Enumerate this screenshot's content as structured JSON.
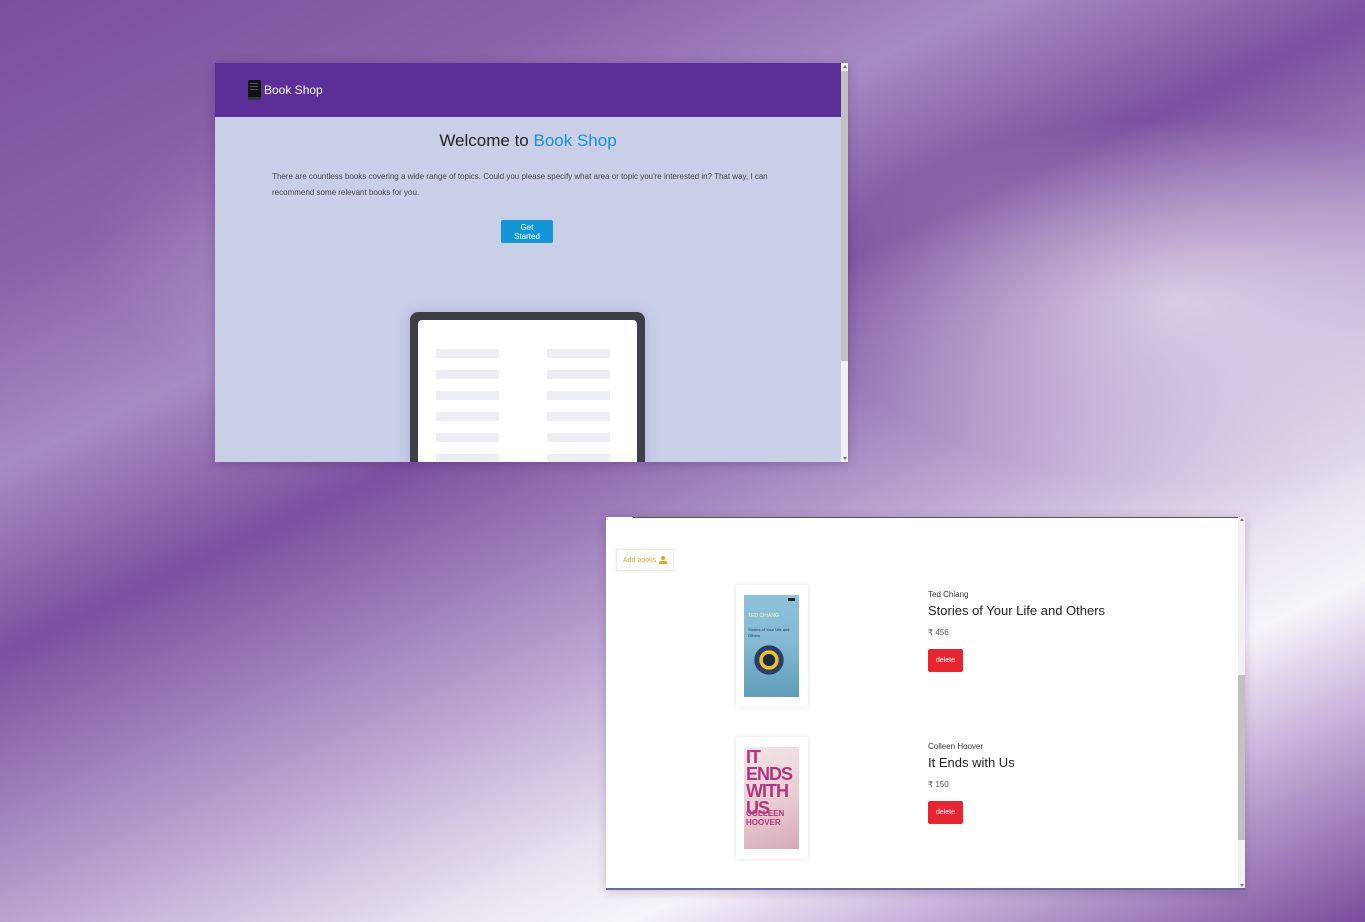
{
  "home": {
    "brand": "Book Shop",
    "title_prefix": "Welcome to ",
    "title_accent": "Book Shop",
    "description": "There are countless books covering a wide range of topics. Could you please specify what area or topic you're interested in? That way, I can recommend some relevant books for you.",
    "cta_label": "Get Started"
  },
  "books_page": {
    "add_label": "Add books",
    "books": [
      {
        "author": "Ted Chiang",
        "title": "Stories of Your Life and Others",
        "price": "₹ 456",
        "delete_label": "delete",
        "cover_text": "TED CHIANG",
        "cover_subtitle": "Stories of Your Life and Others"
      },
      {
        "author": "Colleen Hoover",
        "title": "It Ends with Us",
        "price": "₹ 150",
        "delete_label": "delete",
        "cover_text": "IT ENDS WITH US",
        "cover_author": "COLLEEN HOOVER"
      }
    ]
  },
  "colors": {
    "navbar": "#5b2f97",
    "accent_blue": "#1593d6",
    "delete_red": "#e8242f",
    "add_orange": "#f0a233"
  },
  "icons": {
    "brand": "book-icon",
    "add": "user-upload-icon"
  }
}
